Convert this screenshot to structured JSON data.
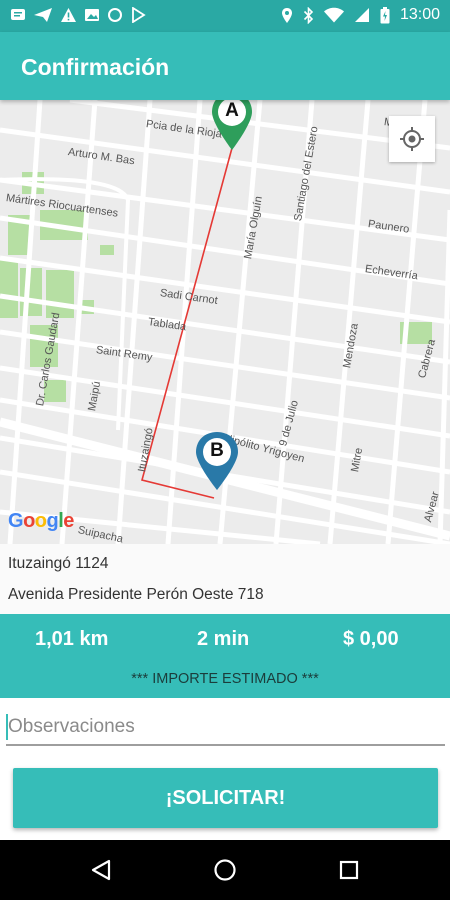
{
  "status_bar": {
    "time": "13:00",
    "icons_left": [
      "message-icon",
      "send-icon",
      "warning-icon",
      "image-icon",
      "circle-icon",
      "play-store-icon"
    ],
    "icons_right": [
      "location-icon",
      "bluetooth-icon",
      "wifi-icon",
      "signal-icon",
      "battery-icon"
    ]
  },
  "app_bar": {
    "title": "Confirmación"
  },
  "map": {
    "street_labels": [
      "Pcia de la Rioja",
      "Arturo M. Bas",
      "Mártires Riocuartenses",
      "Santiago del Estero",
      "María Olguín",
      "Paunero",
      "Echeverría",
      "Sadi Carnot",
      "Tablada",
      "Saint Remy",
      "Dr. Carlos Gaudard",
      "Maipú",
      "Mendoza",
      "Cabrera",
      "Ituzaingó",
      "Hipólito Yrigoyen",
      "9 de Julio",
      "Mitre",
      "Alvear",
      "Suipacha",
      "Mo"
    ],
    "marker_a": "A",
    "marker_b": "B",
    "route_color": "#e53935",
    "attribution": {
      "g1": "G",
      "o1": "o",
      "o2": "o",
      "g2": "g",
      "l": "l",
      "e": "e"
    },
    "locate_icon": "my-location-icon"
  },
  "addresses": {
    "origin": "Ituzaingó 1124",
    "destination": "Avenida Presidente Perón Oeste 718"
  },
  "summary": {
    "distance": "1,01 km",
    "duration": "2 min",
    "price": "$ 0,00",
    "estimate_note": "*** IMPORTE ESTIMADO ***"
  },
  "form": {
    "observations_placeholder": "Observaciones",
    "observations_value": ""
  },
  "actions": {
    "request_label": "¡SOLICITAR!"
  },
  "colors": {
    "primary": "#36bdb8",
    "status": "#2aa9a4",
    "marker_a": "#2e9e5b",
    "marker_b": "#2979a8"
  }
}
